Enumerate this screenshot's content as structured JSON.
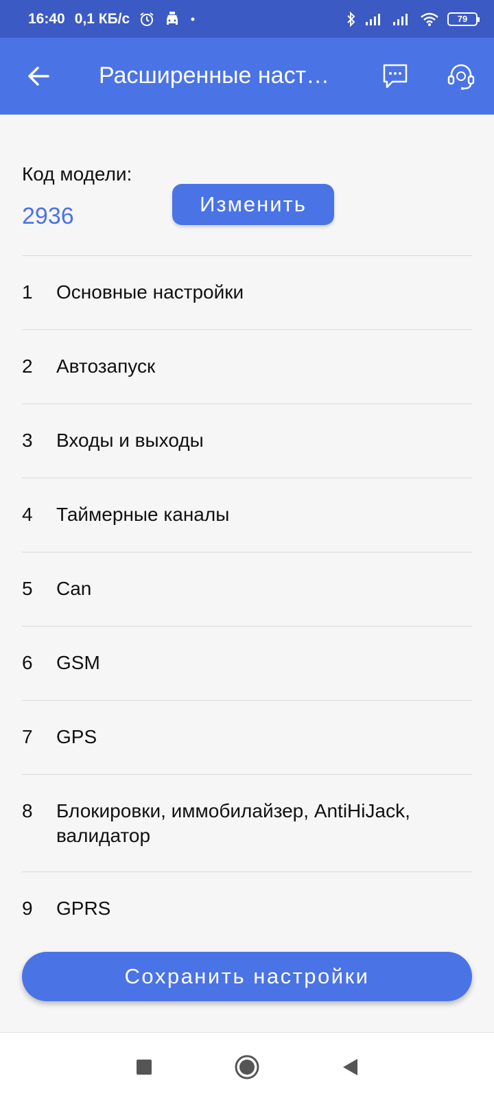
{
  "status_bar": {
    "time": "16:40",
    "net_speed": "0,1 КБ/с",
    "battery": "79",
    "icons": [
      "alarm-icon",
      "car-icon",
      "dot-icon",
      "bluetooth-icon",
      "signal-icon",
      "signal-icon",
      "wifi-icon",
      "battery-icon"
    ]
  },
  "app_bar": {
    "title": "Расширенные настройки",
    "icons": [
      "back-arrow-icon",
      "chat-icon",
      "headset-icon"
    ]
  },
  "model": {
    "label": "Код модели:",
    "code": "2936",
    "change_label": "Изменить"
  },
  "settings": {
    "items": [
      {
        "num": "1",
        "label": "Основные настройки"
      },
      {
        "num": "2",
        "label": "Автозапуск"
      },
      {
        "num": "3",
        "label": "Входы и выходы"
      },
      {
        "num": "4",
        "label": "Таймерные каналы"
      },
      {
        "num": "5",
        "label": "Can"
      },
      {
        "num": "6",
        "label": "GSM"
      },
      {
        "num": "7",
        "label": "GPS"
      },
      {
        "num": "8",
        "label": "Блокировки, иммобилайзер, AntiHiJack, валидатор"
      },
      {
        "num": "9",
        "label": "GPRS"
      }
    ]
  },
  "save_label": "Сохранить настройки",
  "colors": {
    "status_bar": "#3c5ac3",
    "accent": "#4a73e6",
    "background": "#f6f6f6"
  }
}
